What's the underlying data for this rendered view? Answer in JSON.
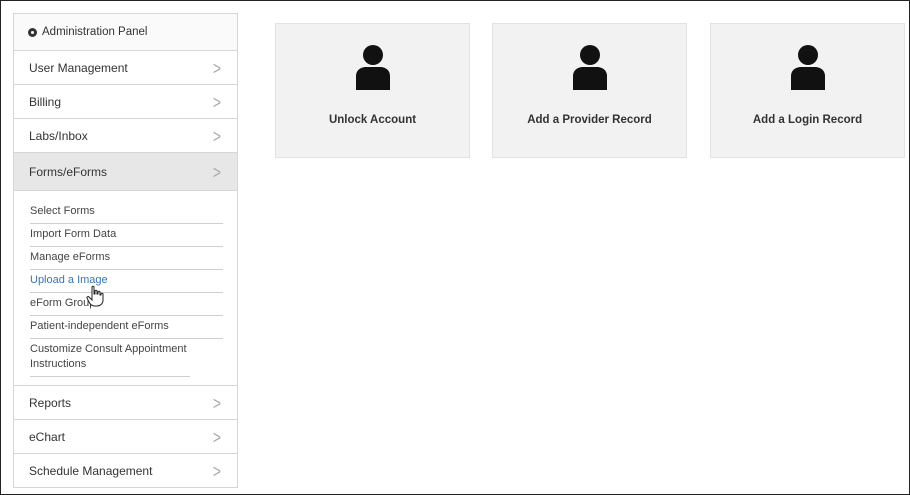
{
  "sidebar": {
    "header": {
      "icon": "gear-icon",
      "label": "Administration Panel"
    },
    "items_top": [
      {
        "label": "User Management",
        "chevron": ">"
      },
      {
        "label": "Billing",
        "chevron": ">"
      },
      {
        "label": "Labs/Inbox",
        "chevron": ">"
      },
      {
        "label": "Forms/eForms",
        "chevron": ">"
      }
    ],
    "submenu": [
      "Select Forms",
      "Import Form Data",
      "Manage eForms",
      "Upload a Image",
      "eForm Groups",
      "Patient-independent eForms",
      "Customize Consult Appointment Instructions"
    ],
    "items_bottom": [
      {
        "label": "Reports",
        "chevron": ">"
      },
      {
        "label": "eChart",
        "chevron": ">"
      },
      {
        "label": "Schedule Management",
        "chevron": ">"
      }
    ]
  },
  "cards": [
    {
      "icon": "user-icon",
      "label": "Unlock Account"
    },
    {
      "icon": "user-icon",
      "label": "Add a Provider Record"
    },
    {
      "icon": "user-icon",
      "label": "Add a Login Record"
    }
  ],
  "colors": {
    "link_hover": "#3a73b5",
    "active_bg": "#e7e7e7",
    "card_bg": "#f2f2f2"
  }
}
